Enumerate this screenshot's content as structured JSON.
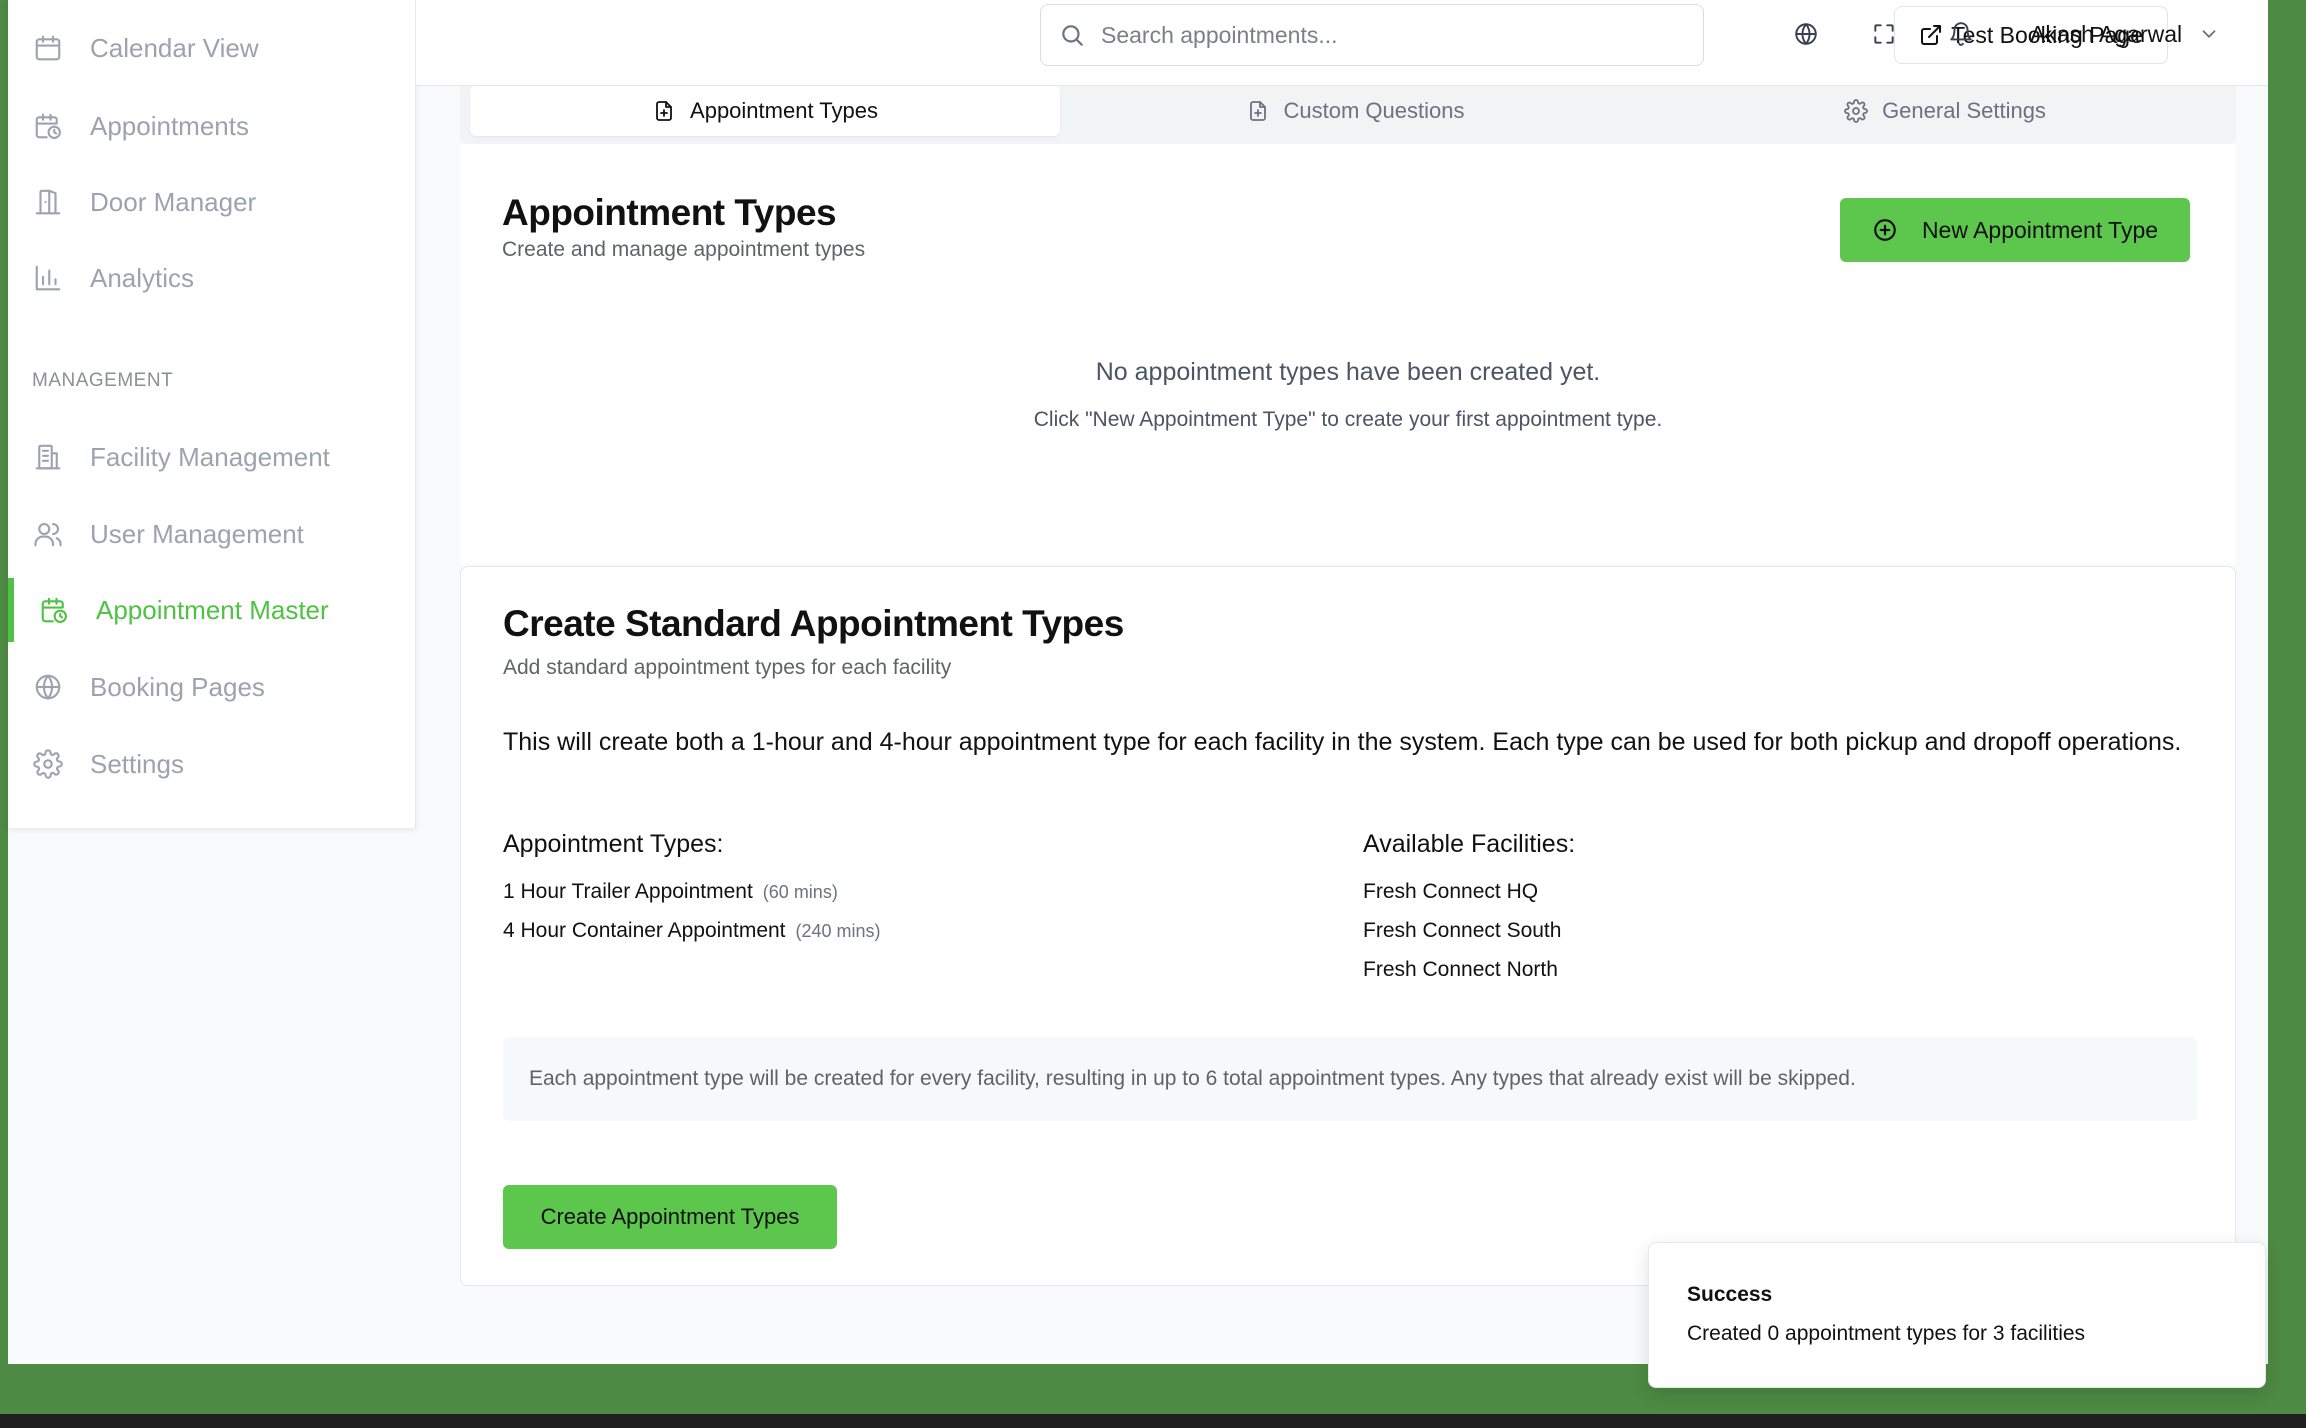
{
  "sidebar": {
    "items": [
      {
        "label": "Calendar View",
        "icon": "calendar-icon"
      },
      {
        "label": "Appointments",
        "icon": "calendar-clock-icon"
      },
      {
        "label": "Door Manager",
        "icon": "door-icon"
      },
      {
        "label": "Analytics",
        "icon": "bar-chart-icon"
      }
    ],
    "section_label": "MANAGEMENT",
    "management_items": [
      {
        "label": "Facility Management",
        "icon": "building-icon"
      },
      {
        "label": "User Management",
        "icon": "users-icon"
      },
      {
        "label": "Appointment Master",
        "icon": "calendar-clock-icon",
        "active": true
      },
      {
        "label": "Booking Pages",
        "icon": "globe-icon"
      },
      {
        "label": "Settings",
        "icon": "gear-icon"
      }
    ]
  },
  "header": {
    "search_placeholder": "Search appointments...",
    "test_booking_label": "Test Booking Page",
    "user_name": "Akash Agarwal"
  },
  "tabs": [
    {
      "label": "Appointment Types",
      "active": true
    },
    {
      "label": "Custom Questions"
    },
    {
      "label": "General Settings"
    }
  ],
  "appointment_types_card": {
    "title": "Appointment Types",
    "subtitle": "Create and manage appointment types",
    "new_button_label": "New Appointment Type",
    "empty_title": "No appointment types have been created yet.",
    "empty_subtitle": "Click \"New Appointment Type\" to create your first appointment type."
  },
  "standard_card": {
    "title": "Create Standard Appointment Types",
    "subtitle": "Add standard appointment types for each facility",
    "description": "This will create both a 1-hour and 4-hour appointment type for each facility in the system. Each type can be used for both pickup and dropoff operations.",
    "types_heading": "Appointment Types:",
    "types": [
      {
        "name": "1 Hour Trailer Appointment",
        "duration": "(60 mins)"
      },
      {
        "name": "4 Hour Container Appointment",
        "duration": "(240 mins)"
      }
    ],
    "facilities_heading": "Available Facilities:",
    "facilities": [
      "Fresh Connect HQ",
      "Fresh Connect South",
      "Fresh Connect North"
    ],
    "note": "Each appointment type will be created for every facility, resulting in up to 6 total appointment types. Any types that already exist will be skipped.",
    "create_button_label": "Create Appointment Types"
  },
  "toast": {
    "title": "Success",
    "message": "Created 0 appointment types for 3 facilities"
  },
  "colors": {
    "accent": "#5cc64d",
    "active_nav": "#4fc245",
    "background_frame": "#4d8a43"
  }
}
